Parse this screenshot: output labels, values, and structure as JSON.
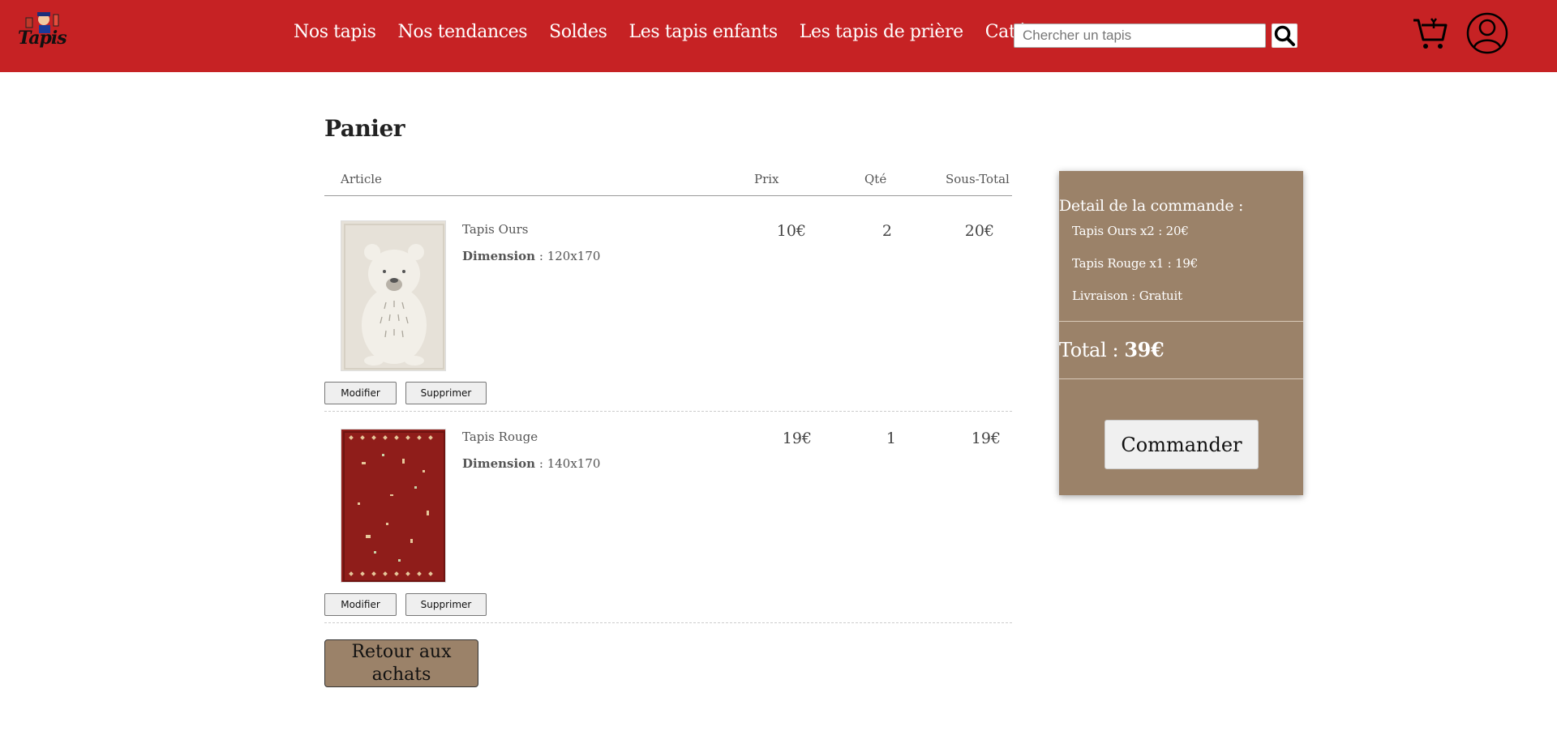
{
  "header": {
    "nav": [
      "Nos tapis",
      "Nos tendances",
      "Soldes",
      "Les tapis enfants",
      "Les tapis de prière",
      "Catégorie"
    ],
    "logo_text": "Tapis",
    "search_placeholder": "Chercher un tapis",
    "colors": {
      "bar": "#c62224"
    },
    "icons": [
      "search-icon",
      "cart-icon",
      "user-icon"
    ]
  },
  "cart": {
    "title": "Panier",
    "columns": {
      "article": "Article",
      "price": "Prix",
      "qty": "Qté",
      "subtotal": "Sous-Total"
    },
    "items": [
      {
        "name": "Tapis Ours",
        "dim_label": "Dimension",
        "dim_value": ": 120x170",
        "price": "10€",
        "qty": "2",
        "subtotal": "20€",
        "edit": "Modifier",
        "delete": "Supprimer"
      },
      {
        "name": "Tapis Rouge",
        "dim_label": "Dimension",
        "dim_value": ": 140x170",
        "price": "19€",
        "qty": "1",
        "subtotal": "19€",
        "edit": "Modifier",
        "delete": "Supprimer"
      }
    ],
    "back_button": "Retour aux achats"
  },
  "summary": {
    "heading": "Detail de la commande :",
    "lines": [
      "Tapis Ours x2 : 20€",
      "Tapis Rouge x1 : 19€",
      "Livraison : Gratuit"
    ],
    "total_label": "Total :",
    "total_value": "39€",
    "order_button": "Commander",
    "colors": {
      "panel": "#9b8269"
    }
  }
}
